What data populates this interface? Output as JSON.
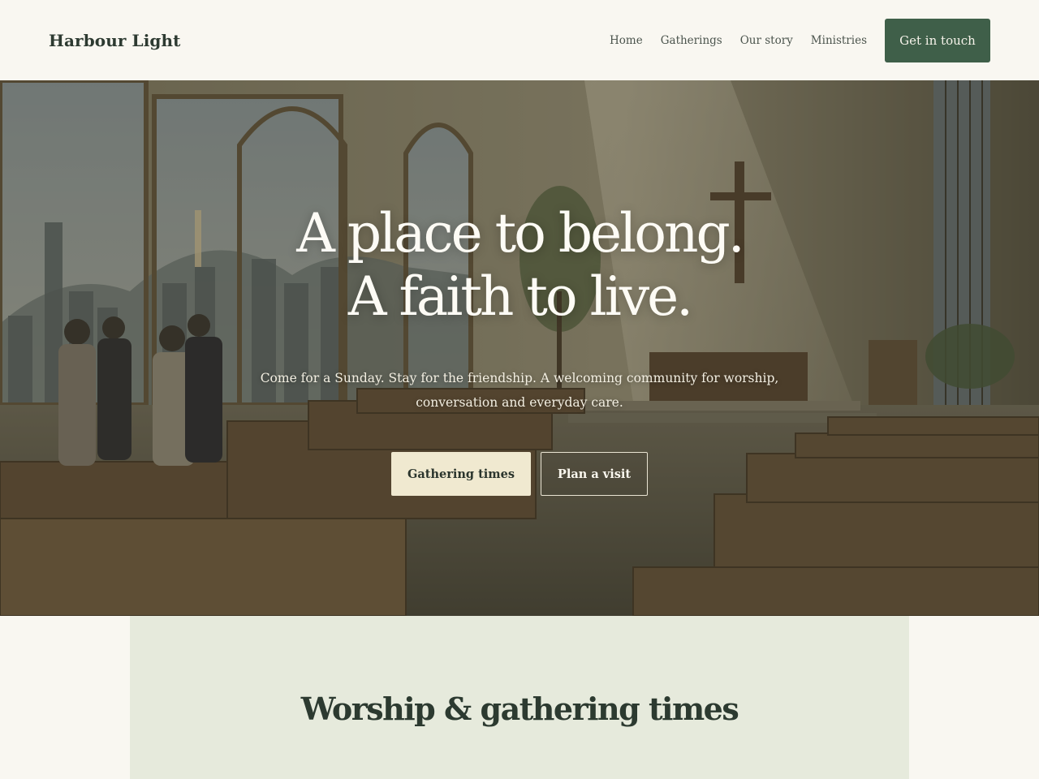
{
  "header": {
    "brand": "Harbour Light",
    "nav": [
      "Home",
      "Gatherings",
      "Our story",
      "Ministries"
    ],
    "cta_label": "Get in touch"
  },
  "hero": {
    "title_line1": "A place to belong.",
    "title_line2": "A faith to live.",
    "subtitle_line1": "Come for a Sunday. Stay for the friendship. A welcoming community for worship,",
    "subtitle_line2": "conversation and everyday care.",
    "primary_button": "Gathering times",
    "secondary_button": "Plan a visit",
    "image_description": "church-interior-with-pews-and-cross"
  },
  "gathering": {
    "title": "Worship & gathering times"
  },
  "colors": {
    "page_bg": "#f9f7f1",
    "brand_green": "#3f5f49",
    "cream_button": "#f0e9d0",
    "section_bg": "#e6eadc",
    "heading": "#2c3a30"
  }
}
